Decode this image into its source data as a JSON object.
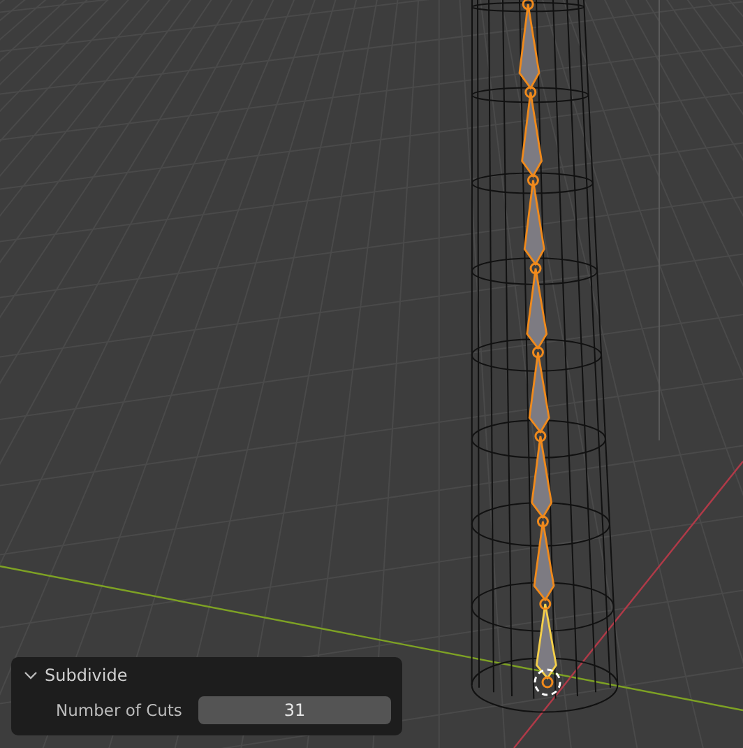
{
  "operator_panel": {
    "title": "Subdivide",
    "expanded": true,
    "fields": [
      {
        "label": "Number of Cuts",
        "value": "31"
      }
    ]
  }
}
